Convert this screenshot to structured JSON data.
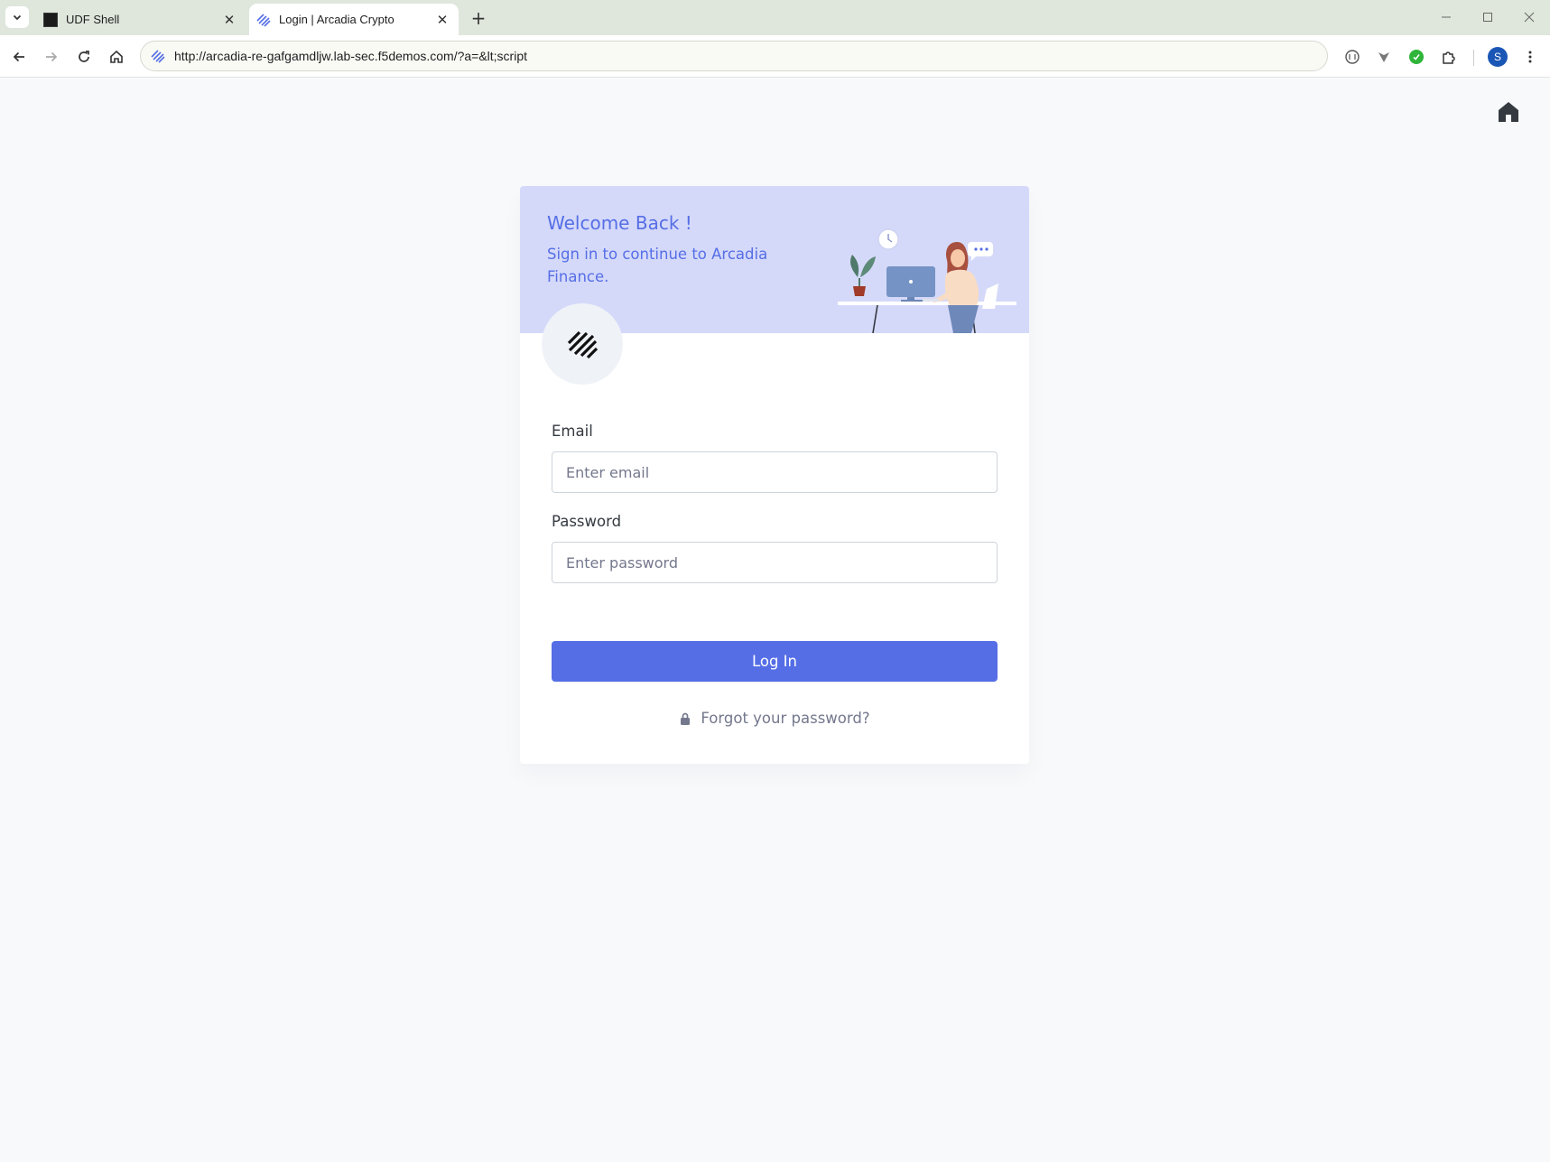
{
  "browser": {
    "tabs": [
      {
        "title": "UDF Shell",
        "active": false,
        "icon": "terminal-icon"
      },
      {
        "title": "Login | Arcadia Crypto",
        "active": true,
        "icon": "arcadia-logo-icon"
      }
    ],
    "url": "http://arcadia-re-gafgamdljw.lab-sec.f5demos.com/?a=&lt;script",
    "profile_initial": "S",
    "colors": {
      "tabstrip": "#dfe7dc",
      "profile": "#1a56b5"
    }
  },
  "page": {
    "home_icon": "home-icon",
    "card": {
      "welcome_title": "Welcome Back !",
      "subtitle": "Sign in to continue to Arcadia Finance.",
      "logo_icon": "arcadia-logo-icon",
      "email": {
        "label": "Email",
        "placeholder": "Enter email",
        "value": ""
      },
      "password": {
        "label": "Password",
        "placeholder": "Enter password",
        "value": ""
      },
      "login_button": "Log In",
      "forgot_password": "Forgot your password?",
      "forgot_icon": "lock-icon"
    },
    "colors": {
      "accent": "#556ee6",
      "header_bg": "#d5d9f9",
      "page_bg": "#f8f9fb",
      "logo_circle": "#eff2f7"
    }
  }
}
